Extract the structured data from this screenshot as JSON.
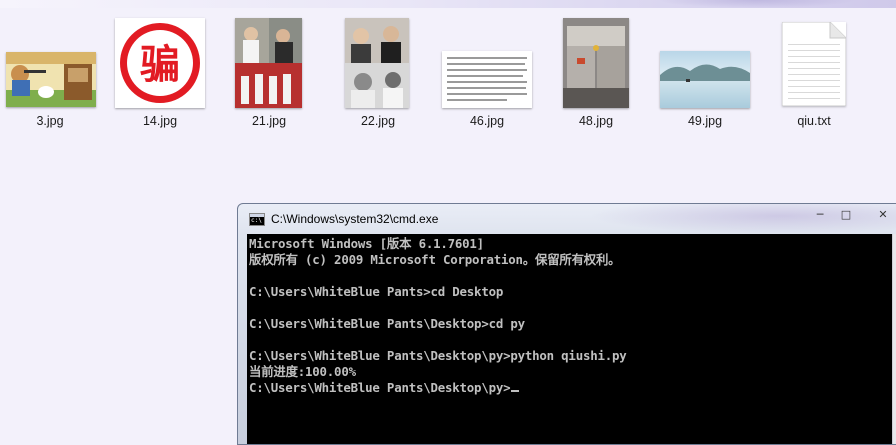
{
  "desktop": {
    "files": [
      {
        "name": "3.jpg"
      },
      {
        "name": "14.jpg",
        "logo_text": "骗"
      },
      {
        "name": "21.jpg"
      },
      {
        "name": "22.jpg"
      },
      {
        "name": "46.jpg"
      },
      {
        "name": "48.jpg"
      },
      {
        "name": "49.jpg"
      },
      {
        "name": "qiu.txt"
      }
    ]
  },
  "cmd": {
    "title": "C:\\Windows\\system32\\cmd.exe",
    "icon": "cmd-icon",
    "controls": {
      "minimize": "─",
      "maximize": "□",
      "close": "✕"
    },
    "lines": [
      "Microsoft Windows [版本 6.1.7601]",
      "版权所有 (c) 2009 Microsoft Corporation。保留所有权利。",
      "",
      "C:\\Users\\WhiteBlue Pants>cd Desktop",
      "",
      "C:\\Users\\WhiteBlue Pants\\Desktop>cd py",
      "",
      "C:\\Users\\WhiteBlue Pants\\Desktop\\py>python qiushi.py",
      "当前进度:100.00%",
      "C:\\Users\\WhiteBlue Pants\\Desktop\\py>"
    ]
  },
  "colors": {
    "desktop_bg": "#f3f1fb",
    "console_bg": "#000000",
    "console_text": "#c0c0c0",
    "logo_red": "#e21b23"
  }
}
